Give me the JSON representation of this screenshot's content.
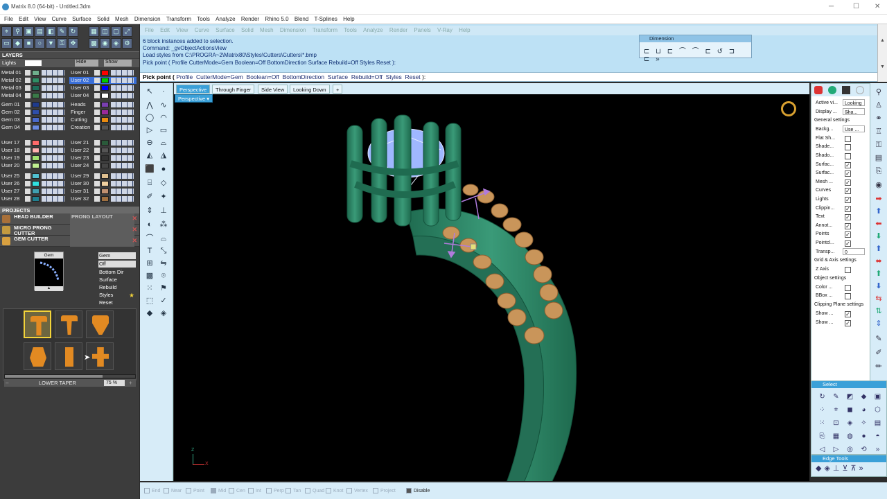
{
  "window": {
    "title": "Matrix 8.0 (64-bit) - Untitled.3dm",
    "minimize": "─",
    "maximize": "☐",
    "close": "✕"
  },
  "menu": [
    "File",
    "Edit",
    "View",
    "Curve",
    "Surface",
    "Solid",
    "Mesh",
    "Dimension",
    "Transform",
    "Tools",
    "Analyze",
    "Render",
    "Rhino 5.0",
    "Blend",
    "T-Splines",
    "Help"
  ],
  "ghost_menu": [
    "File",
    "Edit",
    "View",
    "Curve",
    "Surface",
    "Solid",
    "Mesh",
    "Dimension",
    "Transform",
    "Tools",
    "Analyze",
    "Render",
    "Panels",
    "V-Ray",
    "Help"
  ],
  "command_history": [
    "6 block instances added to selection.",
    "Command: _gvObjectActionsView",
    "Load styles from C:\\PROGRA~2\\Matrix80\\Styles\\Cutters\\Cutters\\*.bmp",
    "Pick point ( Profile  CutterMode=Gem  Boolean=Off  BottomDirection  Surface  Rebuild=Off  Styles  Reset ):"
  ],
  "prompt": {
    "label": "Pick point (",
    "options": [
      "Profile",
      "CutterMode=Gem",
      "Boolean=Off",
      "BottomDirection",
      "Surface",
      "Rebuild=Off",
      "Styles",
      "Reset"
    ],
    "end": "):"
  },
  "dimension_toolbar": {
    "title": "Dimension"
  },
  "layers": {
    "title": "LAYERS",
    "current": "Lights",
    "hide_label": "Hide",
    "show_label": "Show",
    "groups": [
      [
        {
          "left": "Metal 01",
          "lc": "#6fae8c",
          "right": "User 01",
          "rc": "#ff0000"
        },
        {
          "left": "Metal 02",
          "lc": "#2f8f66",
          "right": "User 02",
          "rc": "#00cc00"
        },
        {
          "left": "Metal 03",
          "lc": "#1d6e5a",
          "right": "User 03",
          "rc": "#0000ff"
        },
        {
          "left": "Metal 04",
          "lc": "#3a7a48",
          "right": "User 04",
          "rc": "#ffffff"
        }
      ],
      [
        {
          "left": "Gem 01",
          "lc": "#1f3b8c",
          "right": "Heads",
          "rc": "#7a3fb0"
        },
        {
          "left": "Gem 02",
          "lc": "#2f4faa",
          "right": "Finger",
          "rc": "#9a2a9a"
        },
        {
          "left": "Gem 03",
          "lc": "#4a6acc",
          "right": "Cutting",
          "rc": "#e88a10"
        },
        {
          "left": "Gem 04",
          "lc": "#6a8ae0",
          "right": "Creation",
          "rc": "#555555"
        }
      ],
      [
        {
          "left": "User 17",
          "lc": "#ff6a6a",
          "right": "User 21",
          "rc": "#2a5a3a"
        },
        {
          "left": "User 18",
          "lc": "#ffb0b0",
          "right": "User 22",
          "rc": "#555555"
        },
        {
          "left": "User 19",
          "lc": "#a0e070",
          "right": "User 23",
          "rc": "#333333"
        },
        {
          "left": "User 20",
          "lc": "#c0f090",
          "right": "User 24",
          "rc": "#444444"
        }
      ],
      [
        {
          "left": "User 25",
          "lc": "#50c0d0",
          "right": "User 29",
          "rc": "#e0c090"
        },
        {
          "left": "User 26",
          "lc": "#30e0e0",
          "right": "User 30",
          "rc": "#f0d0a0"
        },
        {
          "left": "User 27",
          "lc": "#40a0b0",
          "right": "User 31",
          "rc": "#c09070"
        },
        {
          "left": "User 28",
          "lc": "#208090",
          "right": "User 32",
          "rc": "#a07040"
        }
      ]
    ]
  },
  "projects": {
    "title": "PROJECTS",
    "items": [
      {
        "name": "HEAD BUILDER",
        "right": "PRONG LAYOUT"
      },
      {
        "name": "MICRO PRONG CUTTER",
        "right": ""
      },
      {
        "name": "GEM CUTTER",
        "right": ""
      }
    ]
  },
  "gem_cutter": {
    "preview_label": "Gem",
    "props": [
      "Gem",
      "Off",
      "Bottom Dir",
      "Surface",
      "Rebuild",
      "Styles",
      "Reset"
    ],
    "slider_label": "LOWER TAPER",
    "slider_value": "75 %",
    "slider_level": 0.75
  },
  "viewport_tabs": [
    "Perspective",
    "Through Finger",
    "Side View",
    "Looking Down"
  ],
  "viewport_label": "Perspective",
  "axis": {
    "z": "Z",
    "x": "X"
  },
  "osnaps": [
    {
      "label": "End",
      "checked": false
    },
    {
      "label": "Near",
      "checked": false
    },
    {
      "label": "Point",
      "checked": false
    },
    {
      "label": "Mid",
      "checked": true
    },
    {
      "label": "Cen",
      "checked": false
    },
    {
      "label": "Int",
      "checked": false
    },
    {
      "label": "Perp",
      "checked": false
    },
    {
      "label": "Tan",
      "checked": false
    },
    {
      "label": "Quad",
      "checked": false
    },
    {
      "label": "Knot",
      "checked": false
    },
    {
      "label": "Vertex",
      "checked": false
    },
    {
      "label": "Project",
      "checked": false
    },
    {
      "label": "Disable",
      "checked": false
    }
  ],
  "properties_panel": {
    "top": [
      {
        "label": "Active vi...",
        "value": "Looking ..."
      },
      {
        "label": "Display ...",
        "value": "Sha..."
      }
    ],
    "general_title": "General settings",
    "background": {
      "label": "Backg...",
      "value": "Use ..."
    },
    "general": [
      {
        "label": "Flat Sh...",
        "checked": false
      },
      {
        "label": "Shade...",
        "checked": false
      },
      {
        "label": "Shado...",
        "checked": false
      },
      {
        "label": "Surfac...",
        "checked": true
      },
      {
        "label": "Surfac...",
        "checked": true
      },
      {
        "label": "Mesh ...",
        "checked": true
      },
      {
        "label": "Curves",
        "checked": true
      },
      {
        "label": "Lights",
        "checked": true
      },
      {
        "label": "Clippin...",
        "checked": true
      },
      {
        "label": "Text",
        "checked": true
      },
      {
        "label": "Annot...",
        "checked": true
      },
      {
        "label": "Points",
        "checked": true
      },
      {
        "label": "Pointcl...",
        "checked": true
      }
    ],
    "transparency": {
      "label": "Transp...",
      "value": "0"
    },
    "grid_title": "Grid & Axis settings",
    "zaxis": {
      "label": "Z Axis",
      "checked": false
    },
    "object_title": "Object settings",
    "object": [
      {
        "label": "Color ...",
        "checked": false
      },
      {
        "label": "BBox ...",
        "checked": false
      }
    ],
    "clip_title": "Clipping Plane settings",
    "clip": [
      {
        "label": "Show ...",
        "checked": true
      },
      {
        "label": "Show ...",
        "checked": true
      }
    ]
  },
  "select_panel": {
    "title": "Select"
  },
  "edge_panel": {
    "title": "Edge Tools"
  },
  "colors": {
    "ring": "#2f8a68",
    "gem": "#c9955a",
    "viewport_bg": "#000000",
    "accent": "#3aa0d8"
  }
}
